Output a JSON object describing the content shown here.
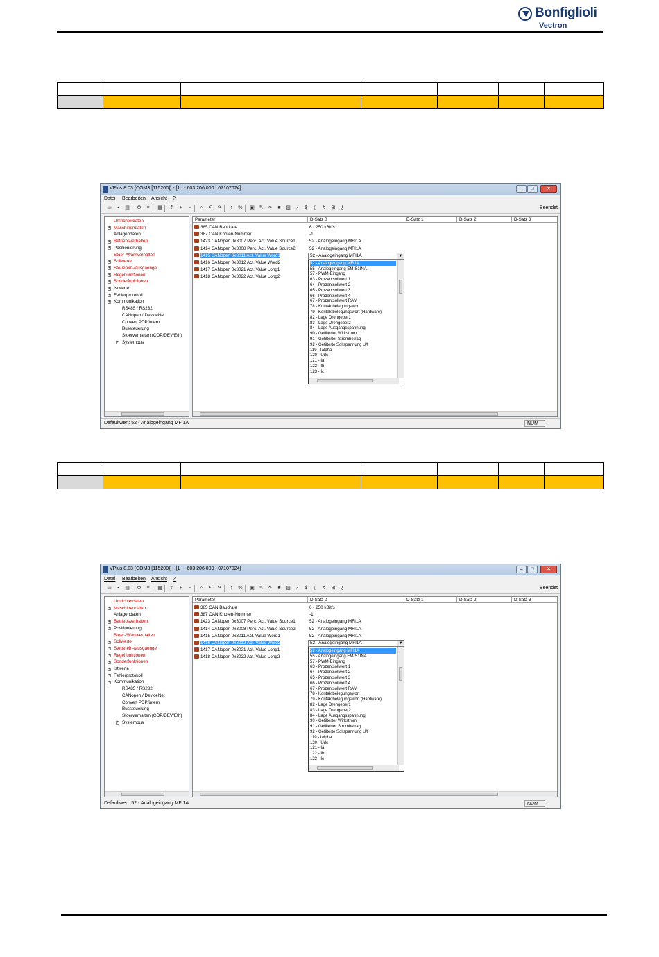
{
  "header": {
    "brand": "Bonfiglioli",
    "subbrand": "Vectron"
  },
  "screens": [
    {
      "title": "VPlus 8.03 (COM3 [115200]) - [1 : - 603 206 000 ; 07107024]",
      "selected_row_index": 3,
      "combo_value": "52 - Analogeingang MFI1A",
      "combo_row_index": 4
    },
    {
      "title": "VPlus 8.03 (COM3 [115200]) - [1 : - 603 206 000 ; 07107024]",
      "selected_row_index": 4,
      "combo_value": "52 - Analogeingang MFI1A",
      "combo_row_index": 5
    }
  ],
  "menu": [
    "Datei",
    "Bearbeiten",
    "Ansicht",
    "?"
  ],
  "toolbar": {
    "end_label": "Beendet"
  },
  "tree": [
    {
      "label": "Umrichterdaten",
      "red": true,
      "level": 0,
      "exp": false
    },
    {
      "label": "Maschinendaten",
      "red": true,
      "level": 0,
      "exp": true
    },
    {
      "label": "Anlagendaten",
      "red": false,
      "level": 0,
      "exp": false
    },
    {
      "label": "Betriebsverhalten",
      "red": true,
      "level": 0,
      "exp": true
    },
    {
      "label": "Positionierung",
      "red": false,
      "level": 0,
      "exp": true
    },
    {
      "label": "Stoer-/Warnverhalten",
      "red": true,
      "level": 0,
      "exp": false
    },
    {
      "label": "Sollwerte",
      "red": true,
      "level": 0,
      "exp": true
    },
    {
      "label": "Steuerein-/ausgaenge",
      "red": true,
      "level": 0,
      "exp": true
    },
    {
      "label": "Regelfunktionen",
      "red": true,
      "level": 0,
      "exp": true
    },
    {
      "label": "Sonderfunktionen",
      "red": true,
      "level": 0,
      "exp": true
    },
    {
      "label": "Istwerte",
      "red": false,
      "level": 0,
      "exp": true
    },
    {
      "label": "Fehlerprotokoll",
      "red": false,
      "level": 0,
      "exp": true
    },
    {
      "label": "Kommunikation",
      "red": false,
      "level": 0,
      "exp": true
    },
    {
      "label": "RS485 / RS232",
      "red": false,
      "level": 1,
      "exp": false
    },
    {
      "label": "CANopen / DeviceNet",
      "red": false,
      "level": 1,
      "exp": false
    },
    {
      "label": "Convert PDP/intern",
      "red": false,
      "level": 1,
      "exp": false
    },
    {
      "label": "Bussteuerung",
      "red": false,
      "level": 1,
      "exp": false
    },
    {
      "label": "Stoerverhalten (COP/DEV/Eth)",
      "red": false,
      "level": 1,
      "exp": false
    },
    {
      "label": "Systembus",
      "red": false,
      "level": 1,
      "exp": true
    }
  ],
  "columns": [
    "Parameter",
    "D-Satz 0",
    "D-Satz 1",
    "D-Satz 2",
    "D-Satz 3"
  ],
  "parameters": [
    {
      "label": "385  CAN Baudrate",
      "value": "6 - 250 kBit/s"
    },
    {
      "label": "387  CAN Knoten-Nummer",
      "value": "-1"
    },
    {
      "label": "1423  CANopen 0x3007 Perc. Act. Value Source1",
      "value": "52 - Analogeingang MFI1A"
    },
    {
      "label": "1414  CANopen 0x3008 Perc. Act. Value Source2",
      "value": "52 - Analogeingang MFI1A"
    },
    {
      "label": "1415  CANopen 0x3011 Act. Value Word1",
      "value": "52 - Analogeingang MFI1A"
    },
    {
      "label": "1416  CANopen 0x3012 Act. Value Word2",
      "value": ""
    },
    {
      "label": "1417  CANopen 0x3021 Act. Value Long1",
      "value": ""
    },
    {
      "label": "1418  CANopen 0x3022 Act. Value Long2",
      "value": ""
    }
  ],
  "dropdown": [
    "52 - Analogeingang MFI1A",
    "55 - Analogeingang EM-S1INA",
    "57 - PWM-Eingang",
    "63 - Prozentsollwert 1",
    "64 - Prozentsollwert 2",
    "65 - Prozentsollwert 3",
    "66 - Prozentsollwert 4",
    "67 - Prozentsollwert RAM",
    "78 - Kontaktbelegungswort",
    "79 - Kontaktbelegungswort (Hardware)",
    "82 - Lage Drehgeber1",
    "83 - Lage Drehgeber2",
    "84 - Lage Ausgangsspannung",
    "90 - Gefilterter Wirkstrom",
    "91 - Gefilterter Strombetrag",
    "92 - Gefilterte Sollspannung U/f",
    "119 - Ialpha",
    "120 - Udc",
    "121 - Ia",
    "122 - Ib",
    "123 - Ic"
  ],
  "status": {
    "text": "Defaultwert: 52 - Analogeingang MFI1A",
    "num": "NUM"
  }
}
